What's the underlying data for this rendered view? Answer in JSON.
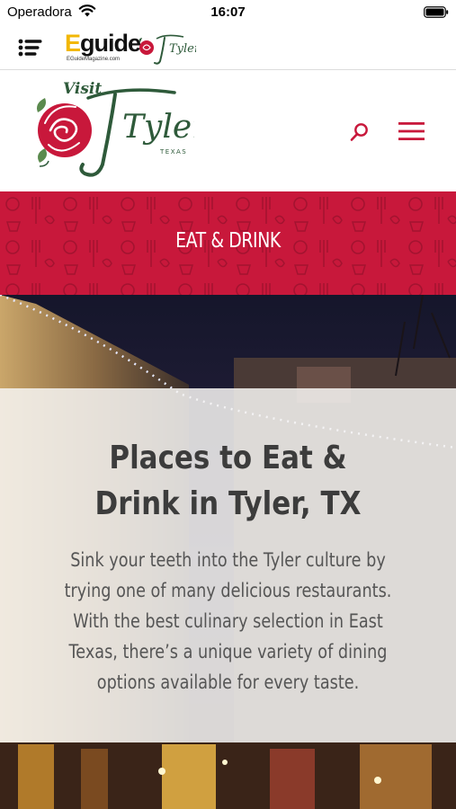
{
  "status_bar": {
    "carrier": "Operadora",
    "time": "16:07",
    "icons": [
      "wifi-icon",
      "battery-icon"
    ]
  },
  "app_bar": {
    "menu_icon": "list-menu-icon",
    "eguide_logo": {
      "word_e": "E",
      "word_rest": "guide",
      "url": "EGuideMagazine.com"
    },
    "partner_logo": {
      "text": "Tyler"
    }
  },
  "site_header": {
    "logo": {
      "visit": "Visit",
      "name": "Tyler",
      "state": "TEXAS"
    },
    "search_icon": "search-icon",
    "menu_icon": "hamburger-icon"
  },
  "banner": {
    "title": "EAT & DRINK",
    "color": "#c8183b"
  },
  "intro": {
    "title": "Places to Eat & Drink in Tyler, TX",
    "body": "Sink your teeth into the Tyler culture by trying one of many delicious restaurants. With the best culinary selection in East Texas, there’s a unique variety of dining options available for every taste."
  },
  "colors": {
    "brand_red": "#c8183b",
    "logo_green": "#2e5a3a",
    "text_gray": "#555555"
  }
}
